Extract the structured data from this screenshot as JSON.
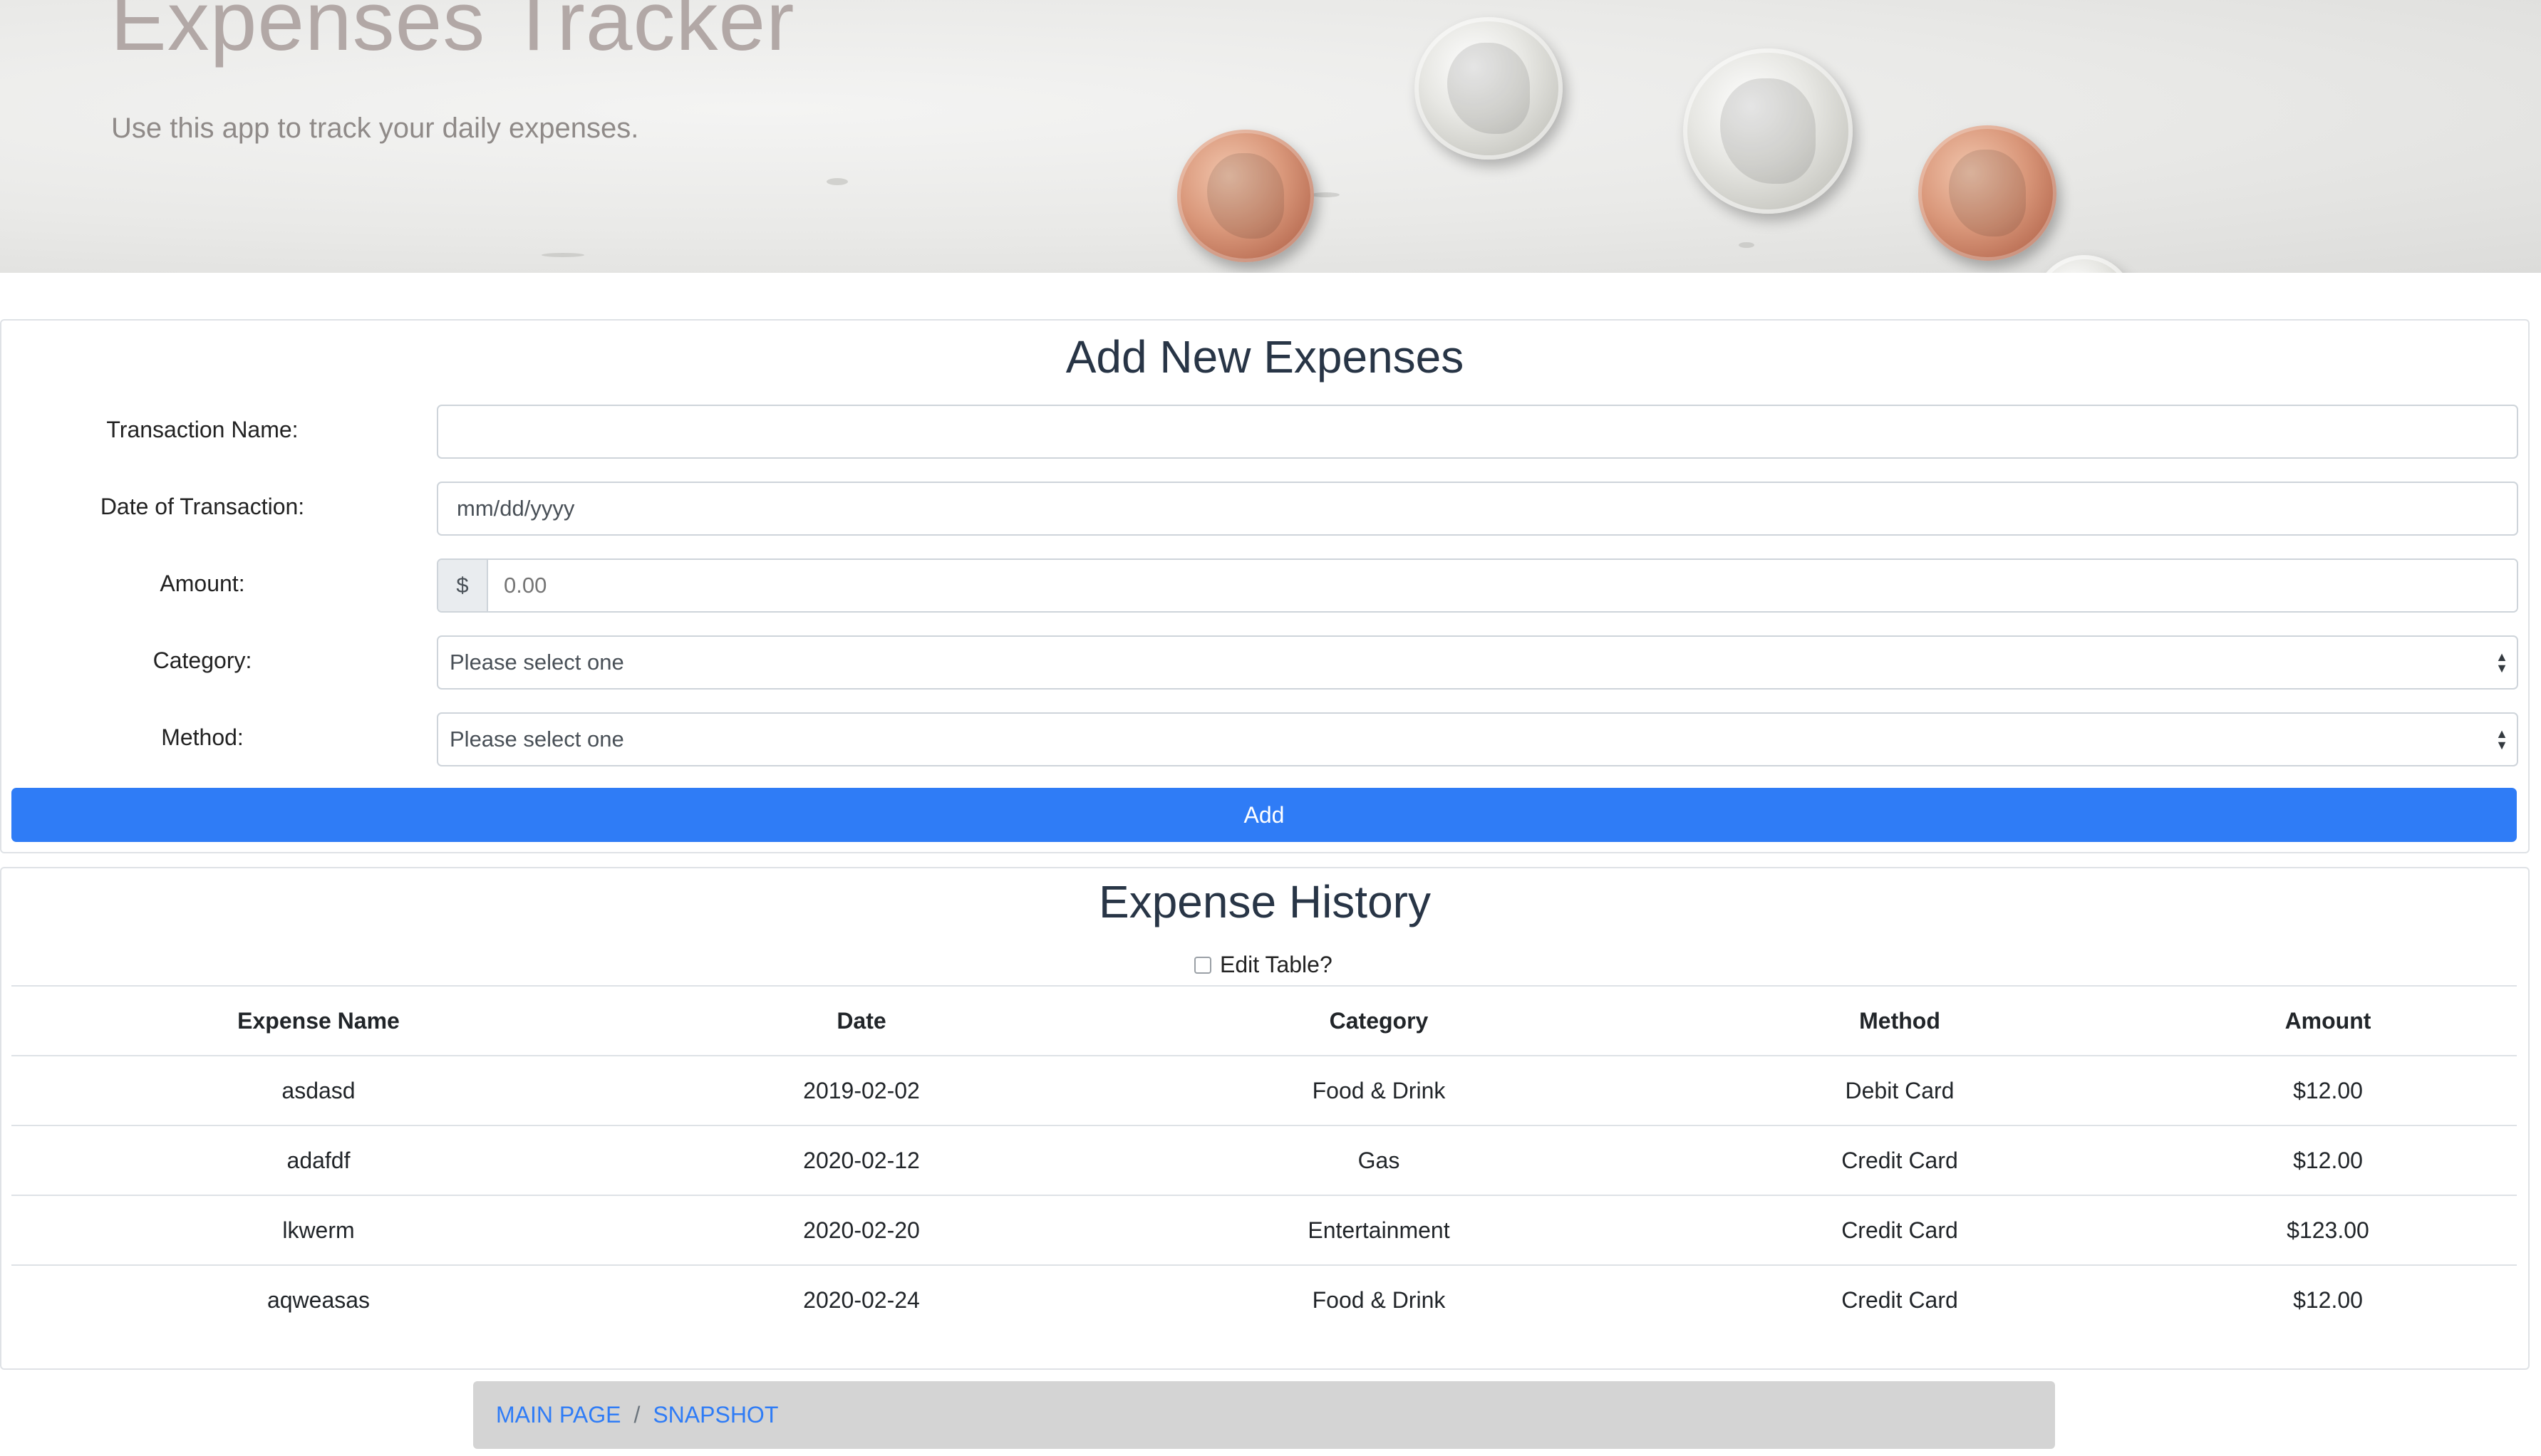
{
  "hero": {
    "title": "Expenses Tracker",
    "subtitle": "Use this app to track your daily expenses."
  },
  "add_form": {
    "title": "Add New Expenses",
    "fields": {
      "transaction_name": {
        "label": "Transaction Name:",
        "value": "",
        "placeholder": ""
      },
      "date": {
        "label": "Date of Transaction:",
        "placeholder": "mm/dd/yyyy"
      },
      "amount": {
        "label": "Amount:",
        "prefix": "$",
        "placeholder": "0.00"
      },
      "category": {
        "label": "Category:",
        "selected": "Please select one"
      },
      "method": {
        "label": "Method:",
        "selected": "Please select one"
      }
    },
    "submit_label": "Add"
  },
  "history": {
    "title": "Expense History",
    "edit_toggle_label": "Edit Table?",
    "edit_checked": false,
    "columns": [
      "Expense Name",
      "Date",
      "Category",
      "Method",
      "Amount"
    ],
    "rows": [
      [
        "asdasd",
        "2019-02-02",
        "Food & Drink",
        "Debit Card",
        "$12.00"
      ],
      [
        "adafdf",
        "2020-02-12",
        "Gas",
        "Credit Card",
        "$12.00"
      ],
      [
        "lkwerm",
        "2020-02-20",
        "Entertainment",
        "Credit Card",
        "$123.00"
      ],
      [
        "aqweasas",
        "2020-02-24",
        "Food & Drink",
        "Credit Card",
        "$12.00"
      ]
    ]
  },
  "breadcrumb": {
    "items": [
      "MAIN PAGE",
      "SNAPSHOT"
    ],
    "separator": "/"
  },
  "colors": {
    "accent": "#2f7cf6",
    "heading": "#283546",
    "hero_title": "#b2a8a6",
    "breadcrumb_bg": "#d4d4d4"
  }
}
